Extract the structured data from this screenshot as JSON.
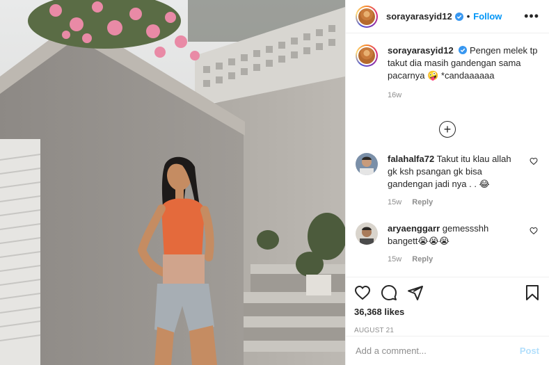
{
  "post": {
    "username": "sorayarasyid12",
    "follow_label": "Follow",
    "more_label": "•••"
  },
  "caption": {
    "username": "sorayarasyid12",
    "text": "Pengen melek tp takut dia masih gandengan sama pacarnya 🤪 *candaaaaaa",
    "time": "16w"
  },
  "comments": [
    {
      "username": "falahalfa72",
      "text": "Takut itu klau allah gk ksh psangan gk bisa gandengan jadi nya . . 😂",
      "time": "15w",
      "reply_label": "Reply"
    },
    {
      "username": "aryaenggarr",
      "text": "gemessshh bangett😭😭😭",
      "time": "15w",
      "reply_label": "Reply"
    }
  ],
  "load_more_label": "+",
  "stats": {
    "likes": "36,368 likes",
    "date": "AUGUST 21"
  },
  "composer": {
    "placeholder": "Add a comment...",
    "post_label": "Post"
  },
  "colors": {
    "accent": "#0095f6",
    "muted": "#8e8e8e",
    "post_disabled": "#b2dffc"
  }
}
